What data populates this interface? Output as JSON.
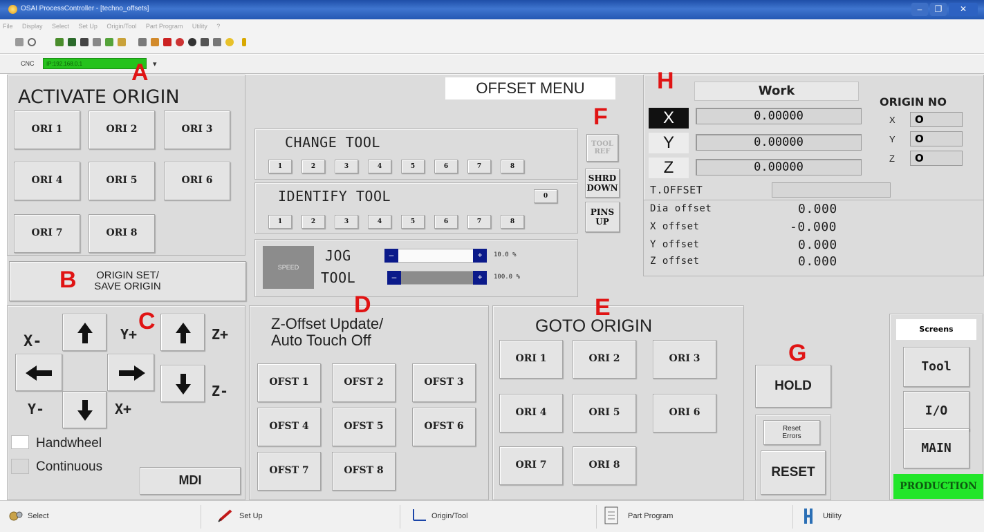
{
  "window": {
    "title": "OSAI ProcessController - [techno_offsets]",
    "buttons": {
      "minimize": "–",
      "restore": "❐",
      "close": "✕"
    }
  },
  "menu": [
    "File",
    "Display",
    "Select",
    "Set Up",
    "Origin/Tool",
    "Part Program",
    "Utility",
    "?"
  ],
  "cnc": {
    "label": "CNC",
    "address": "IP:192.168.0.1",
    "dropdown": "▾"
  },
  "markers": {
    "A": "A",
    "B": "B",
    "C": "C",
    "D": "D",
    "E": "E",
    "F": "F",
    "G": "G",
    "H": "H"
  },
  "activate_origin": {
    "title": "ACTIVATE ORIGIN",
    "buttons": [
      "ORI 1",
      "ORI 2",
      "ORI 3",
      "ORI 4",
      "ORI 5",
      "ORI 6",
      "ORI 7",
      "ORI 8"
    ]
  },
  "origin_set": {
    "line1": "ORIGIN SET/",
    "line2": "SAVE ORIGIN"
  },
  "offset_menu": {
    "title": "OFFSET MENU"
  },
  "change_tool": {
    "title": "CHANGE TOOL",
    "buttons": [
      "1",
      "2",
      "3",
      "4",
      "5",
      "6",
      "7",
      "8"
    ]
  },
  "identify_tool": {
    "title": "IDENTIFY TOOL",
    "zero": "0",
    "buttons": [
      "1",
      "2",
      "3",
      "4",
      "5",
      "6",
      "7",
      "8"
    ]
  },
  "tool_side": {
    "tool_ref_1": "TOOL",
    "tool_ref_2": "REF",
    "shrd_1": "SHRD",
    "shrd_2": "DOWN",
    "pins_1": "PINS",
    "pins_2": "UP"
  },
  "speed": {
    "label": "SPEED",
    "jog_label": "JOG",
    "jog_value": "10.0 %",
    "jog_fraction": 0.0,
    "tool_label": "TOOL",
    "tool_value": "100.0 %",
    "tool_fraction": 1.0,
    "minus": "–",
    "plus": "+"
  },
  "jog": {
    "x_minus": "X-",
    "x_plus": "X+",
    "y_plus": "Y+",
    "y_minus": "Y-",
    "z_plus": "Z+",
    "z_minus": "Z-",
    "handwheel": "Handwheel",
    "continuous": "Continuous",
    "mdi": "MDI"
  },
  "z_offset": {
    "title1": "Z-Offset Update/",
    "title2": "Auto Touch Off",
    "buttons": [
      "OFST 1",
      "OFST 2",
      "OFST 3",
      "OFST 4",
      "OFST 5",
      "OFST 6",
      "OFST 7",
      "OFST 8"
    ]
  },
  "goto_origin": {
    "title": "GOTO ORIGIN",
    "buttons": [
      "ORI 1",
      "ORI 2",
      "ORI 3",
      "ORI 4",
      "ORI 5",
      "ORI 6",
      "ORI 7",
      "ORI 8"
    ]
  },
  "work": {
    "title": "Work",
    "axes": [
      {
        "axis": "X",
        "value": "0.00000"
      },
      {
        "axis": "Y",
        "value": "0.00000"
      },
      {
        "axis": "Z",
        "value": "0.00000"
      }
    ],
    "t_offset_label": "T.OFFSET",
    "t_offset_value": "",
    "offsets": [
      {
        "label": "Dia offset",
        "value": "0.000"
      },
      {
        "label": "X offset",
        "value": "-0.000"
      },
      {
        "label": "Y offset",
        "value": "0.000"
      },
      {
        "label": "Z offset",
        "value": "0.000"
      }
    ]
  },
  "origin_no": {
    "title": "ORIGIN NO",
    "rows": [
      {
        "axis": "X",
        "value": "O"
      },
      {
        "axis": "Y",
        "value": "O"
      },
      {
        "axis": "Z",
        "value": "O"
      }
    ]
  },
  "control": {
    "hold": "HOLD",
    "reset_errors_1": "Reset",
    "reset_errors_2": "Errors",
    "reset": "RESET"
  },
  "screens": {
    "title": "Screens",
    "tool": "Tool",
    "io": "I/O",
    "main": "MAIN",
    "mode": "PRODUCTION"
  },
  "statusbar": [
    "Select",
    "Set Up",
    "Origin/Tool",
    "Part Program",
    "Utility"
  ],
  "colors": {
    "titlebar": "#2458b3",
    "marker": "#e01414",
    "cnc_field": "#25c21c",
    "production": "#22e62a",
    "slider_knob": "#0b1a8a"
  }
}
